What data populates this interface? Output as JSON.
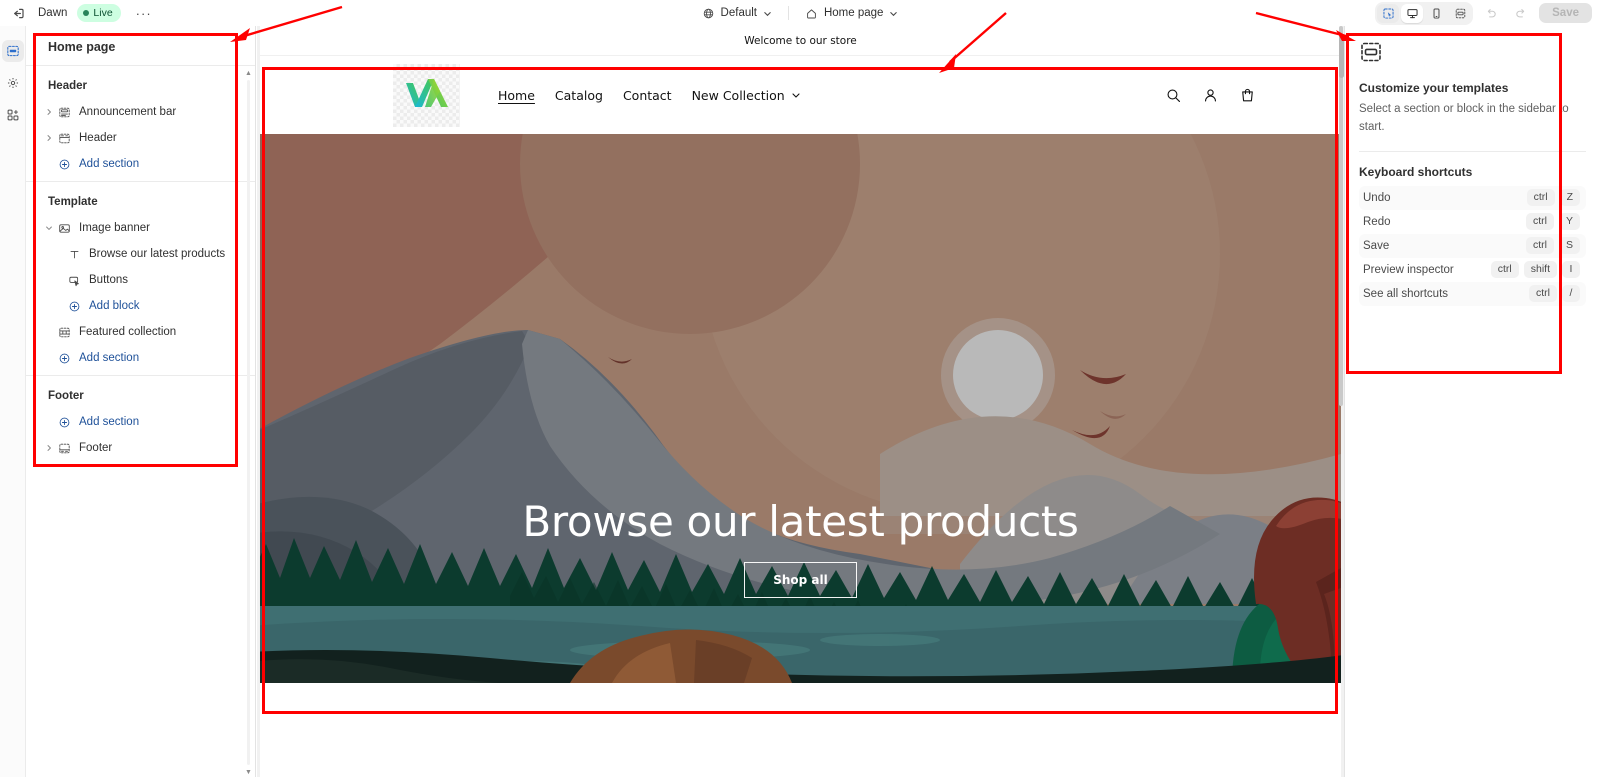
{
  "topbar": {
    "exit_icon": "exit-left-icon",
    "theme_name": "Dawn",
    "status_badge": "Live",
    "more_label": "···",
    "market_selector": {
      "icon": "globe-icon",
      "label": "Default",
      "caret": "chevron-down-icon"
    },
    "page_selector": {
      "icon": "home-icon",
      "label": "Home page",
      "caret": "chevron-down-icon"
    },
    "view_buttons": [
      {
        "name": "inspector-toggle",
        "icon": "cursor-select-icon",
        "state": "active-blue"
      },
      {
        "name": "desktop-view",
        "icon": "desktop-icon",
        "state": "active-white"
      },
      {
        "name": "mobile-view",
        "icon": "mobile-icon",
        "state": "inactive"
      },
      {
        "name": "fullwidth-view",
        "icon": "fullwidth-icon",
        "state": "inactive"
      }
    ],
    "undo_icon": "undo-icon",
    "redo_icon": "redo-icon",
    "save_label": "Save"
  },
  "rail": [
    {
      "name": "sections-rail-button",
      "icon": "sections-icon",
      "active": true
    },
    {
      "name": "theme-settings-rail-button",
      "icon": "gear-icon",
      "active": false
    },
    {
      "name": "apps-rail-button",
      "icon": "apps-grid-icon",
      "active": false
    }
  ],
  "sidebar": {
    "title": "Home page",
    "groups": [
      {
        "label": "Header",
        "rows": [
          {
            "name": "sidebar-item-announcement-bar",
            "caret": "chevron-right-icon",
            "icon": "announcement-bar-icon",
            "label": "Announcement bar",
            "kind": "section"
          },
          {
            "name": "sidebar-item-header",
            "caret": "chevron-right-icon",
            "icon": "header-icon",
            "label": "Header",
            "kind": "section"
          },
          {
            "name": "sidebar-add-section-header",
            "caret": "",
            "icon": "plus-circle-icon",
            "label": "Add section",
            "kind": "add"
          }
        ]
      },
      {
        "label": "Template",
        "rows": [
          {
            "name": "sidebar-item-image-banner",
            "caret": "chevron-down-icon",
            "icon": "image-banner-icon",
            "label": "Image banner",
            "kind": "section"
          },
          {
            "name": "sidebar-block-browse-our-latest-products",
            "caret": "",
            "icon": "text-icon",
            "label": "Browse our latest products",
            "kind": "block"
          },
          {
            "name": "sidebar-block-buttons",
            "caret": "",
            "icon": "button-icon",
            "label": "Buttons",
            "kind": "block"
          },
          {
            "name": "sidebar-add-block",
            "caret": "",
            "icon": "plus-circle-icon",
            "label": "Add block",
            "kind": "add-block"
          },
          {
            "name": "sidebar-item-featured-collection",
            "caret": "",
            "icon": "collection-icon",
            "label": "Featured collection",
            "kind": "section-noc"
          },
          {
            "name": "sidebar-add-section-template",
            "caret": "",
            "icon": "plus-circle-icon",
            "label": "Add section",
            "kind": "add"
          }
        ]
      },
      {
        "label": "Footer",
        "rows": [
          {
            "name": "sidebar-add-section-footer",
            "caret": "",
            "icon": "plus-circle-icon",
            "label": "Add section",
            "kind": "add"
          },
          {
            "name": "sidebar-item-footer",
            "caret": "chevron-right-icon",
            "icon": "footer-icon",
            "label": "Footer",
            "kind": "section"
          }
        ]
      }
    ]
  },
  "preview": {
    "announcement": "Welcome to our store",
    "logo_alt": "store-logo",
    "nav": [
      {
        "name": "store-nav-home",
        "label": "Home",
        "current": true,
        "caret": false
      },
      {
        "name": "store-nav-catalog",
        "label": "Catalog",
        "current": false,
        "caret": false
      },
      {
        "name": "store-nav-contact",
        "label": "Contact",
        "current": false,
        "caret": false
      },
      {
        "name": "store-nav-new-collection",
        "label": "New Collection",
        "current": false,
        "caret": true
      }
    ],
    "icons": [
      {
        "name": "store-search-icon",
        "icon": "search-icon"
      },
      {
        "name": "store-account-icon",
        "icon": "person-icon"
      },
      {
        "name": "store-cart-icon",
        "icon": "cart-icon"
      }
    ],
    "hero": {
      "title": "Browse our latest products",
      "button_label": "Shop all"
    }
  },
  "right_panel": {
    "header_icon": "section-block-icon",
    "heading": "Customize your templates",
    "subtext": "Select a section or block in the sidebar to start.",
    "shortcuts_heading": "Keyboard shortcuts",
    "shortcuts": [
      {
        "name": "shortcut-undo",
        "label": "Undo",
        "keys": [
          "ctrl",
          "Z"
        ]
      },
      {
        "name": "shortcut-redo",
        "label": "Redo",
        "keys": [
          "ctrl",
          "Y"
        ]
      },
      {
        "name": "shortcut-save",
        "label": "Save",
        "keys": [
          "ctrl",
          "S"
        ]
      },
      {
        "name": "shortcut-preview-inspector",
        "label": "Preview inspector",
        "keys": [
          "ctrl",
          "shift",
          "I"
        ]
      },
      {
        "name": "shortcut-see-all",
        "label": "See all shortcuts",
        "keys": [
          "ctrl",
          "/"
        ]
      }
    ]
  },
  "colors": {
    "accent_blue": "#1f5199",
    "live_bg": "#cdfee1",
    "live_text": "#0c5132",
    "annotation_red": "#ff0000",
    "hero_sky": "#9d7b68",
    "hero_water": "#3d6b6e",
    "hero_forest": "#0c3b2e"
  }
}
